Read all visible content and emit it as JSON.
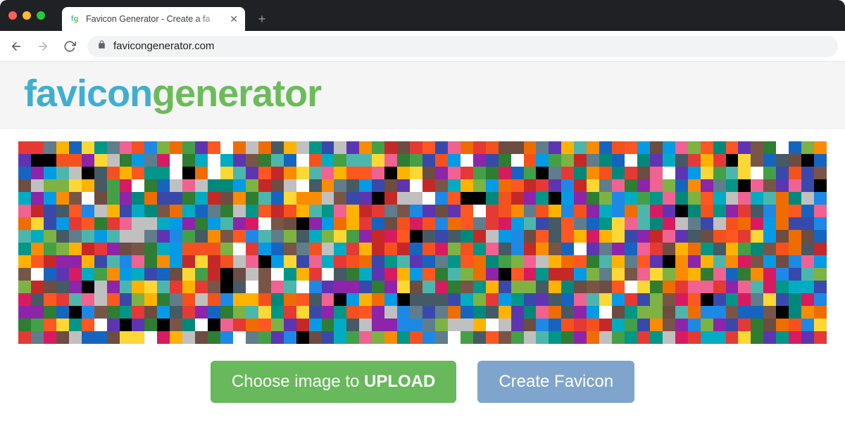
{
  "browser": {
    "tab_title": "Favicon Generator - Create a fa",
    "tab_favicon_f": "f",
    "tab_favicon_g": "g",
    "close_glyph": "✕",
    "newtab_glyph": "+",
    "url": "favicongenerator.com"
  },
  "logo": {
    "part1": "favicon",
    "part2": "generator"
  },
  "buttons": {
    "upload_prefix": "Choose image to ",
    "upload_strong": "UPLOAD",
    "create": "Create Favicon"
  },
  "mosaic": {
    "cols": 64,
    "rows": 16,
    "palette": [
      "#e53935",
      "#1e88e5",
      "#43a047",
      "#fdd835",
      "#fb8c00",
      "#8e24aa",
      "#00897b",
      "#d81b60",
      "#3949ab",
      "#6d4c41",
      "#000000",
      "#ffffff",
      "#c0c0c0",
      "#ff5722",
      "#009688",
      "#795548",
      "#607d8b",
      "#f06292",
      "#4db6ac",
      "#ffb300",
      "#5e35b1",
      "#039be5",
      "#7cb342",
      "#f4511e",
      "#00acc1",
      "#c62828",
      "#2e7d32",
      "#1565c0",
      "#ef6c00",
      "#455a64"
    ]
  }
}
